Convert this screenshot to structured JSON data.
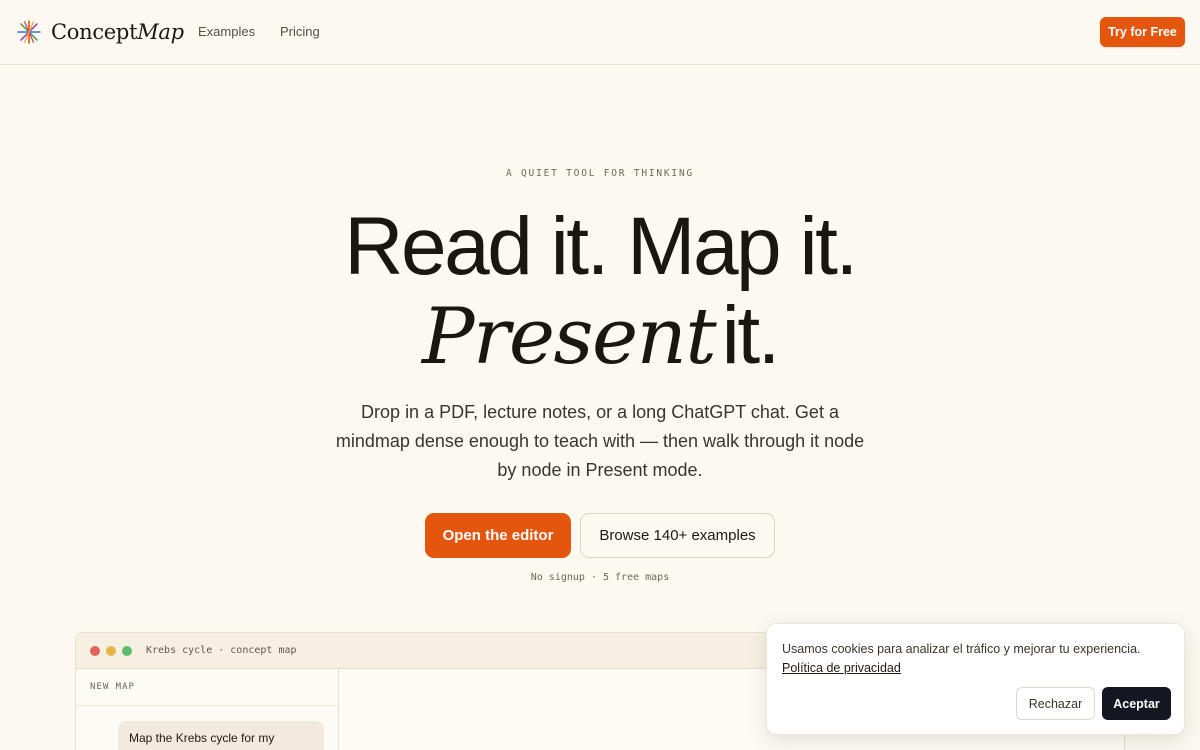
{
  "nav": {
    "brand_a": "Concept",
    "brand_b": "Map",
    "logo_icon": "asterisk-starburst-icon",
    "links": [
      "Examples",
      "Pricing"
    ],
    "cta": "Try for Free"
  },
  "hero": {
    "eyebrow": "A QUIET TOOL FOR THINKING",
    "line1": "Read it. Map it.",
    "line2_serif": "Present",
    "line2_rest": "it.",
    "subtitle": "Drop in a PDF, lecture notes, or a long ChatGPT chat. Get a mindmap dense enough to teach with — then walk through it node by node in Present mode.",
    "primary_cta": "Open the editor",
    "secondary_cta": "Browse 140+ examples",
    "fine_print": "No signup · 5 free maps"
  },
  "preview": {
    "window_title": "Krebs cycle · concept map",
    "sidebar_heading": "NEW MAP",
    "message": "Map the Krebs cycle for my biochem students, with"
  },
  "cookie": {
    "text": "Usamos cookies para analizar el tráfico y mejorar tu experiencia.",
    "link": "Política de privacidad",
    "reject": "Rechazar",
    "accept": "Aceptar"
  },
  "colors": {
    "accent": "#e4560d",
    "background": "#fcf9f1",
    "dark_button": "#161622"
  }
}
